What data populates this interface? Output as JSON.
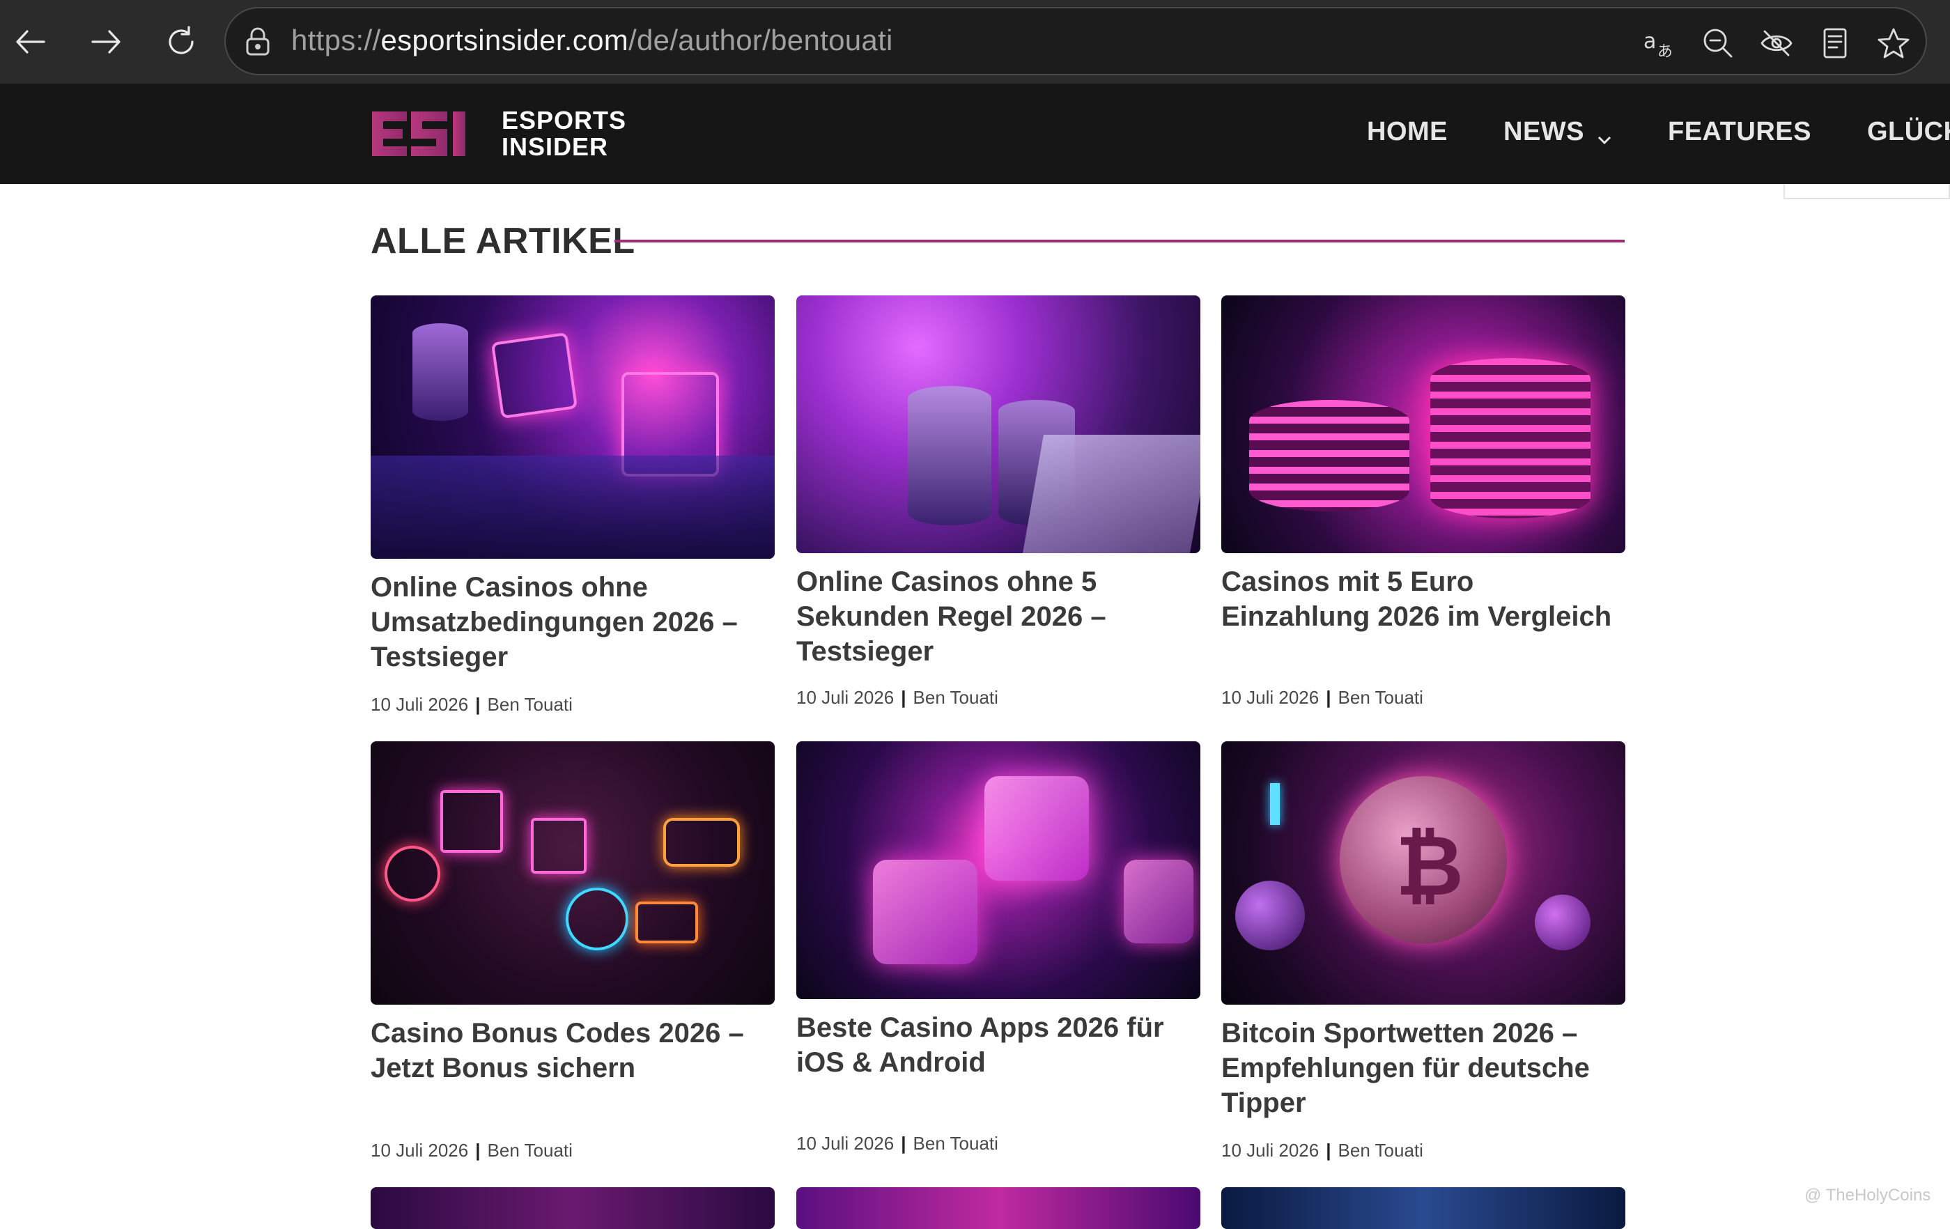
{
  "browser": {
    "url_prefix": "https://",
    "url_host": "esportsinsider.com",
    "url_path": "/de/author/bentouati"
  },
  "header": {
    "logo_text_line1": "ESPORTS",
    "logo_text_line2": "INSIDER",
    "logo_mark": "ESI",
    "nav": [
      {
        "label": "HOME"
      },
      {
        "label": "NEWS"
      },
      {
        "label": "FEATURES"
      },
      {
        "label": "GLÜCKSSP"
      }
    ]
  },
  "section": {
    "title": "ALLE ARTIKEL"
  },
  "articles": [
    {
      "title": "Online Casinos ohne Umsatzbedingungen 2026 – Testsieger",
      "date": "10 Juli 2026",
      "author": "Ben Touati"
    },
    {
      "title": "Online Casinos ohne 5 Sekunden Regel 2026 – Testsieger",
      "date": "10 Juli 2026",
      "author": "Ben Touati"
    },
    {
      "title": "Casinos mit 5 Euro Einzahlung 2026 im Vergleich",
      "date": "10 Juli 2026",
      "author": "Ben Touati"
    },
    {
      "title": "Casino Bonus Codes 2026 – Jetzt Bonus sichern",
      "date": "10 Juli 2026",
      "author": "Ben Touati"
    },
    {
      "title": "Beste Casino Apps 2026 für iOS & Android",
      "date": "10 Juli 2026",
      "author": "Ben Touati"
    },
    {
      "title": "Bitcoin Sportwetten 2026 – Empfehlungen für deutsche Tipper",
      "date": "10 Juli 2026",
      "author": "Ben Touati"
    }
  ],
  "meta_separator": "|",
  "watermark": "@ TheHolyCoins",
  "colors": {
    "accent": "#9a2e74",
    "header_bg": "#161616",
    "chrome_bg": "#2b2b2b"
  }
}
